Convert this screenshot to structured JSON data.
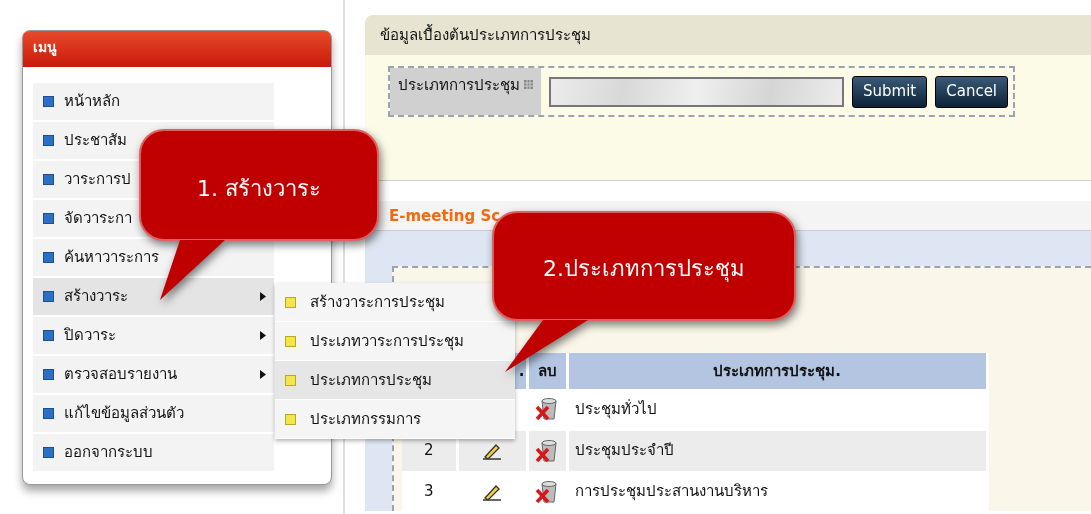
{
  "menu": {
    "title": "เมนู",
    "items": [
      {
        "label": "หน้าหลัก",
        "has_submenu": false,
        "selected": false
      },
      {
        "label": "ประชาสัม",
        "has_submenu": false,
        "selected": false
      },
      {
        "label": "วาระการป",
        "has_submenu": false,
        "selected": false
      },
      {
        "label": "จัดวาระกา",
        "has_submenu": false,
        "selected": false
      },
      {
        "label": "ค้นหาวาระการ",
        "has_submenu": false,
        "selected": false
      },
      {
        "label": "สร้างวาระ",
        "has_submenu": true,
        "selected": true
      },
      {
        "label": "ปิดวาระ",
        "has_submenu": true,
        "selected": false
      },
      {
        "label": "ตรวจสอบรายงาน",
        "has_submenu": true,
        "selected": false
      },
      {
        "label": "แก้ไขข้อมูลส่วนตัว",
        "has_submenu": false,
        "selected": false
      },
      {
        "label": "ออกจากระบบ",
        "has_submenu": false,
        "selected": false
      }
    ]
  },
  "submenu": {
    "items": [
      {
        "label": "สร้างวาระการประชุม",
        "selected": false
      },
      {
        "label": "ประเภทวาระการประชุม",
        "selected": false
      },
      {
        "label": "ประเภทการประชุม",
        "selected": true
      },
      {
        "label": "ประเภทกรรมการ",
        "selected": false
      }
    ]
  },
  "form": {
    "title": "ข้อมูลเบื้องต้นประเภทการประชุม",
    "field_label": "ประเภทการประชุม",
    "buttons": [
      "Submit",
      "Cancel"
    ]
  },
  "section": {
    "title": "E-meeting Sc"
  },
  "table": {
    "columns": [
      ".",
      "ลบ",
      "ประเภทการประชุม."
    ],
    "rows": [
      {
        "name": "ประชุมทั่วไป"
      },
      {
        "number": "2",
        "name": "ประชุมประจำปี"
      },
      {
        "number": "3",
        "name": "การประชุมประสานงานบริหาร"
      }
    ]
  },
  "callouts": [
    {
      "text": "1. สร้างวาระ"
    },
    {
      "text": "2.ประเภทการประชุม"
    }
  ]
}
